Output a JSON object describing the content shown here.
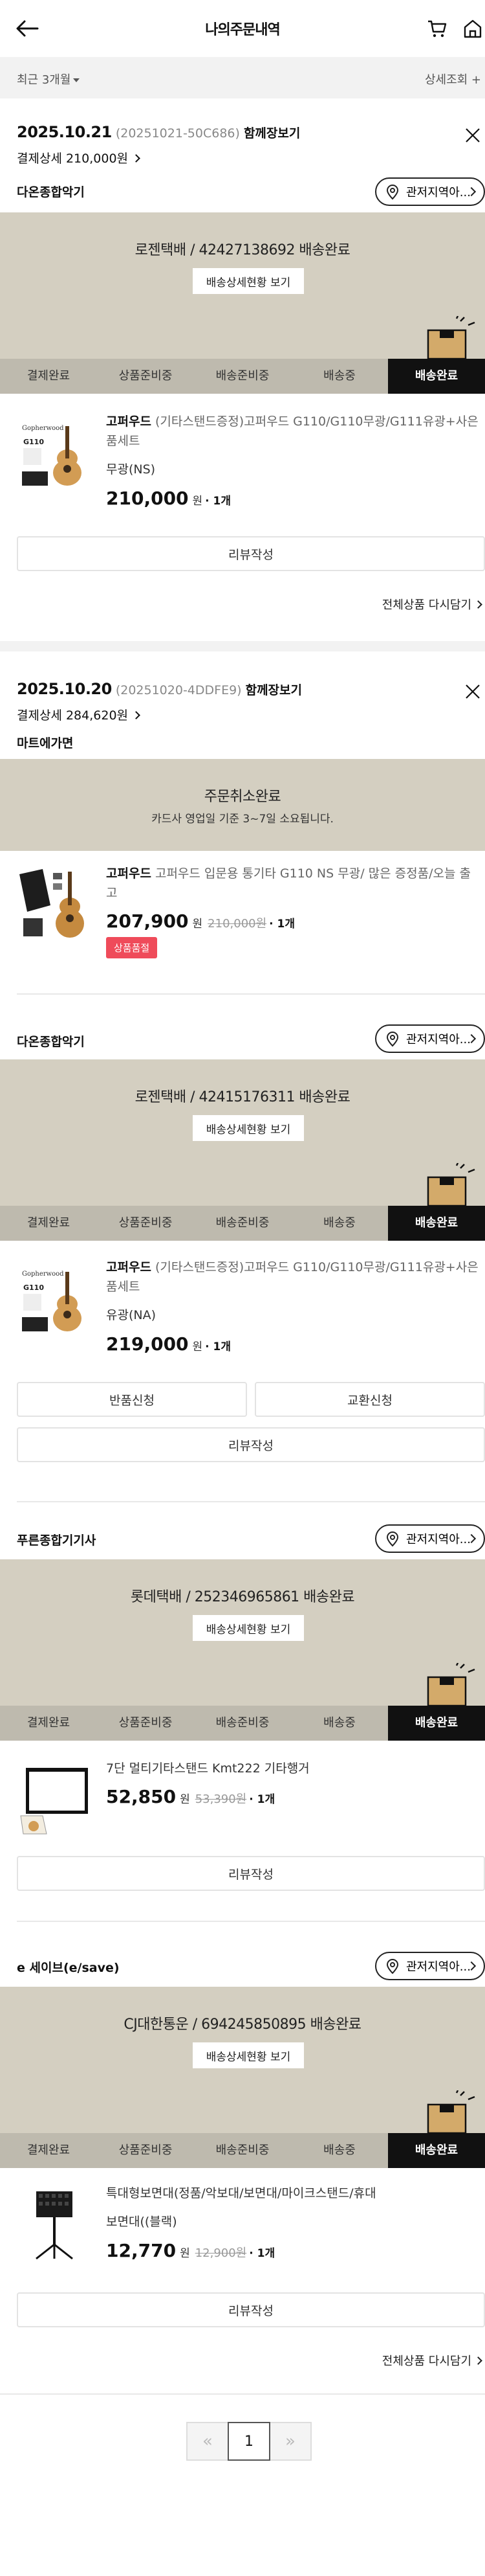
{
  "header": {
    "title": "나의주문내역"
  },
  "filter": {
    "period": "최근 3개월",
    "detail": "상세조회 +"
  },
  "steps": [
    "결제완료",
    "상품준비중",
    "배송준비중",
    "배송중",
    "배송완료"
  ],
  "common": {
    "store_btn": "관저지역아...",
    "tracking_btn": "배송상세현황 보기",
    "review_btn": "리뷰작성",
    "rebuy": "전체상품 다시담기",
    "return_btn": "반품신청",
    "exchange_btn": "교환신청",
    "won": "원",
    "qty": "· 1개"
  },
  "orders": [
    {
      "date": "2025.10.21",
      "order_no": "(20251021-50C686)",
      "cart_link": "함께장보기",
      "pay": "결제상세 210,000원",
      "shipments": [
        {
          "seller": "다온종합악기",
          "delivery": "로젠택배 / 42427138692 배송완료",
          "product": {
            "brand": "고퍼우드",
            "name": "(기타스탠드증정)고퍼우드 G110/G110무광/G111유광+사은품세트",
            "option": "무광(NS)",
            "price": "210,000"
          }
        }
      ]
    },
    {
      "date": "2025.10.20",
      "order_no": "(20251020-4DDFE9)",
      "cart_link": "함께장보기",
      "pay": "결제상세 284,620원",
      "shipments": [
        {
          "seller": "마트에가면",
          "cancel_title": "주문취소완료",
          "cancel_sub": "카드사 영업일 기준 3~7일 소요됩니다.",
          "product": {
            "brand": "고퍼우드",
            "name": "고퍼우드 입문용 통기타 G110 NS 무광/ 많은 증정품/오늘 출고",
            "price": "207,900",
            "orig": "210,000원",
            "tag": "상품품절"
          }
        },
        {
          "seller": "다온종합악기",
          "delivery": "로젠택배 / 42415176311 배송완료",
          "product": {
            "brand": "고퍼우드",
            "name": "(기타스탠드증정)고퍼우드 G110/G110무광/G111유광+사은품세트",
            "option": "유광(NA)",
            "price": "219,000"
          }
        },
        {
          "seller": "푸른종합기기사",
          "delivery": "롯데택배 / 252346965861 배송완료",
          "product": {
            "name": "7단 멀티기타스탠드 Kmt222 기타행거",
            "price": "52,850",
            "orig": "53,390원"
          }
        },
        {
          "seller": "e 세이브(e/save)",
          "delivery": "CJ대한통운 / 694245850895 배송완료",
          "product": {
            "name": "특대형보면대(정품/악보대/보면대/마이크스탠드/휴대",
            "option": "보면대((블랙)",
            "price": "12,770",
            "orig": "12,900원"
          }
        }
      ]
    }
  ],
  "pagination": {
    "prev": "«",
    "current": "1",
    "next": "»"
  }
}
